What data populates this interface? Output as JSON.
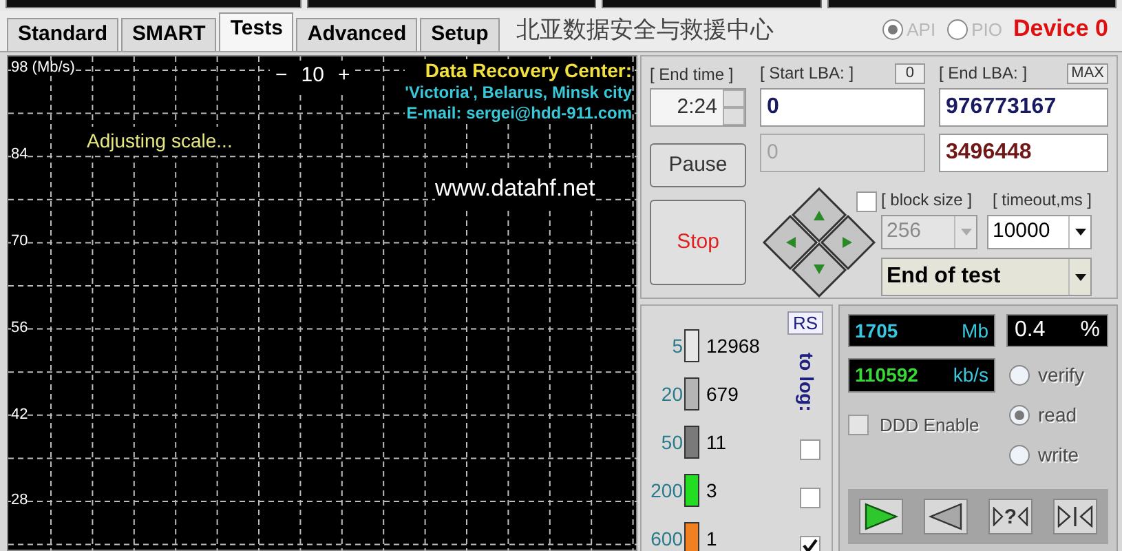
{
  "tabs": [
    {
      "label": "Standard",
      "selected": false
    },
    {
      "label": "SMART",
      "selected": false
    },
    {
      "label": "Tests",
      "selected": true
    },
    {
      "label": "Advanced",
      "selected": false
    },
    {
      "label": "Setup",
      "selected": false
    }
  ],
  "banner": "北亚数据安全与救援中心",
  "interface": [
    {
      "label": "API",
      "selected": true
    },
    {
      "label": "PIO",
      "selected": false
    }
  ],
  "device": "Device 0",
  "graph": {
    "y_labels": [
      "98 (Mb/s)",
      "84",
      "70",
      "56",
      "42",
      "28"
    ],
    "scale": {
      "minus": "−",
      "value": "10",
      "plus": "+"
    },
    "status": "Adjusting scale...",
    "contact": {
      "title": "Data Recovery Center:",
      "lines": [
        "'Victoria', Belarus, Minsk city",
        "E-mail: sergei@hdd-911.com"
      ]
    },
    "website": "www.datahf.net"
  },
  "controls": {
    "end_time": {
      "label": "[ End time ]",
      "value": "2:24"
    },
    "start_lba": {
      "label": "[ Start LBA: ]",
      "reset_button": "0",
      "value": "0",
      "current": "0"
    },
    "end_lba": {
      "label": "[ End LBA: ]",
      "max_button": "MAX",
      "value": "976773167",
      "current": "3496448"
    },
    "pause": "Pause",
    "stop": "Stop",
    "pad_checkbox": {
      "checked": false
    },
    "block_size": {
      "label": "[ block size ]",
      "value": "256",
      "disabled": true
    },
    "timeout": {
      "label": "[ timeout,ms ]",
      "value": "10000",
      "disabled": false
    },
    "action": "End of test"
  },
  "stats": {
    "rs_button": "RS",
    "to_log": "to log:",
    "rows": [
      {
        "label": "5",
        "count": "12968",
        "color": "#e6e6e6"
      },
      {
        "label": "20",
        "count": "679",
        "color": "#b4b4b4"
      },
      {
        "label": "50",
        "count": "11",
        "color": "#7a7a7a"
      },
      {
        "label": "200",
        "count": "3",
        "color": "#22dd22"
      },
      {
        "label": "600",
        "count": "1",
        "color": "#f08020"
      }
    ],
    "log_checks": [
      {
        "checked": false
      },
      {
        "checked": false
      },
      {
        "checked": true
      }
    ]
  },
  "progress": {
    "mb": "1705",
    "mb_unit": "Mb",
    "percent": "0.4",
    "percent_unit": "%",
    "speed": "110592",
    "speed_unit": "kb/s",
    "ddd": {
      "label": "DDD Enable",
      "checked": false
    },
    "modes": [
      {
        "label": "verify",
        "selected": false
      },
      {
        "label": "read",
        "selected": true
      },
      {
        "label": "write",
        "selected": false
      }
    ],
    "buttons": [
      {
        "kind": "play"
      },
      {
        "kind": "back"
      },
      {
        "kind": "query",
        "label": "?"
      },
      {
        "kind": "ends"
      }
    ]
  }
}
